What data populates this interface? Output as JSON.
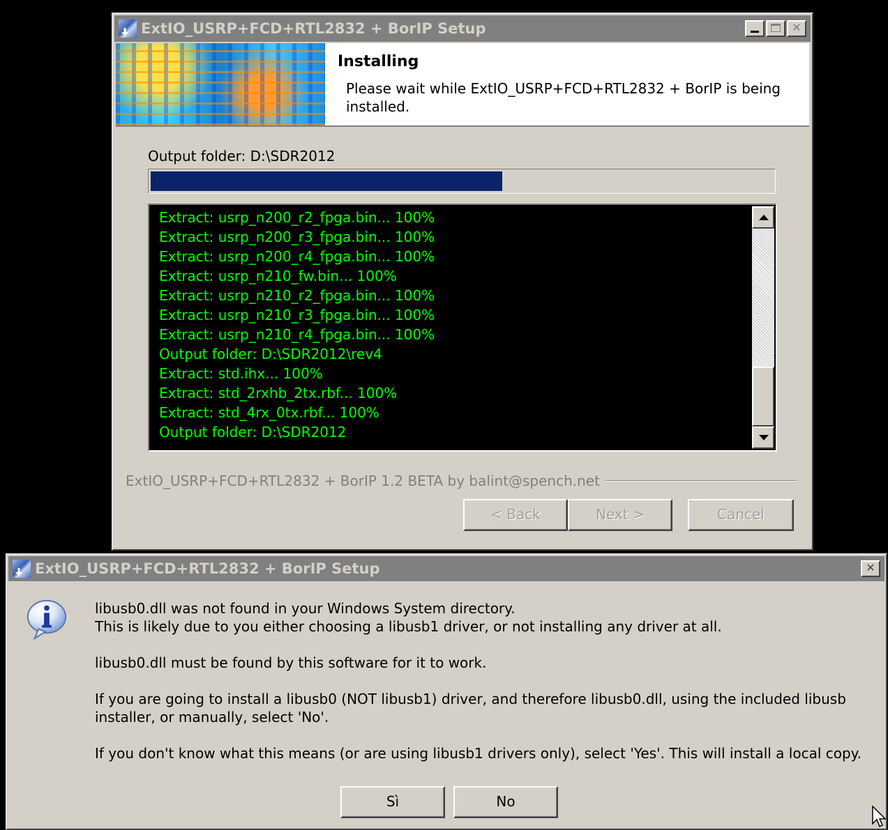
{
  "installer": {
    "title": "ExtIO_USRP+FCD+RTL2832 + BorIP Setup",
    "heading": "Installing",
    "subheading": "Please wait while ExtIO_USRP+FCD+RTL2832 + BorIP is being installed.",
    "output_folder": "Output folder: D:\\SDR2012",
    "progress_fraction": 0.565,
    "log_lines": [
      "Extract: usrp_n200_r2_fpga.bin... 100%",
      "Extract: usrp_n200_r3_fpga.bin... 100%",
      "Extract: usrp_n200_r4_fpga.bin... 100%",
      "Extract: usrp_n210_fw.bin... 100%",
      "Extract: usrp_n210_r2_fpga.bin... 100%",
      "Extract: usrp_n210_r3_fpga.bin... 100%",
      "Extract: usrp_n210_r4_fpga.bin... 100%",
      "Output folder: D:\\SDR2012\\rev4",
      "Extract: std.ihx... 100%",
      "Extract: std_2rxhb_2tx.rbf... 100%",
      "Extract: std_4rx_0tx.rbf... 100%",
      "Output folder: D:\\SDR2012"
    ],
    "branding": "ExtIO_USRP+FCD+RTL2832 + BorIP 1.2 BETA by balint@spench.net",
    "buttons": {
      "back": "< Back",
      "next": "Next >",
      "cancel": "Cancel"
    },
    "log_text_color": "#00ff00",
    "progress_color": "#0a246a"
  },
  "message_box": {
    "title": "ExtIO_USRP+FCD+RTL2832 + BorIP Setup",
    "icon": "info-icon",
    "paragraphs": [
      "libusb0.dll was not found in your Windows System directory.\nThis is likely due to you either choosing a libusb1 driver, or not installing any driver at all.",
      "libusb0.dll must be found by this software for it to work.",
      "If you are going to install a libusb0 (NOT libusb1) driver, and therefore libusb0.dll, using the included libusb installer, or manually, select 'No'.",
      "If you don't know what this means (or are using libusb1 drivers only), select 'Yes'. This will install a local copy."
    ],
    "buttons": {
      "yes": "Sì",
      "no": "No"
    }
  }
}
